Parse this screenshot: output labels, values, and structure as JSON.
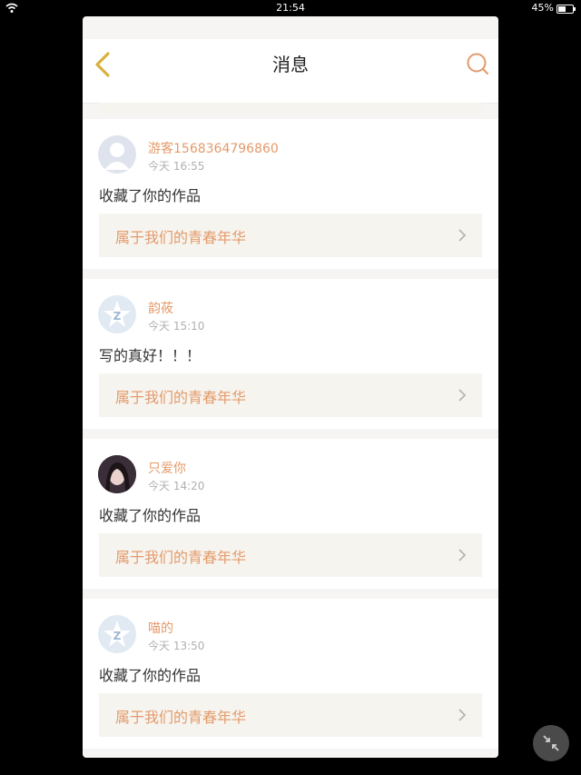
{
  "status_bar": {
    "time": "21:54",
    "battery": "45%",
    "battery_level": 0.45
  },
  "header": {
    "title": "消息",
    "back_icon": "chevron-left-icon",
    "search_icon": "search-icon"
  },
  "messages": [
    {
      "user": "游客1568364796860",
      "time": "今天 16:55",
      "text": "收藏了你的作品",
      "work_title": "属于我们的青春年华",
      "avatar": "default-person-avatar"
    },
    {
      "user": "韵莜",
      "time": "今天 15:10",
      "text": "写的真好！！！",
      "work_title": "属于我们的青春年华",
      "avatar": "logo-avatar"
    },
    {
      "user": "只爱你",
      "time": "今天 14:20",
      "text": "收藏了你的作品",
      "work_title": "属于我们的青春年华",
      "avatar": "photo-avatar"
    },
    {
      "user": "喵的",
      "time": "今天 13:50",
      "text": "收藏了你的作品",
      "work_title": "属于我们的青春年华",
      "avatar": "logo-avatar"
    }
  ],
  "colors": {
    "accent": "#e49a6a",
    "link_bg": "#f6f4ef",
    "back_icon": "#d8b23c"
  }
}
